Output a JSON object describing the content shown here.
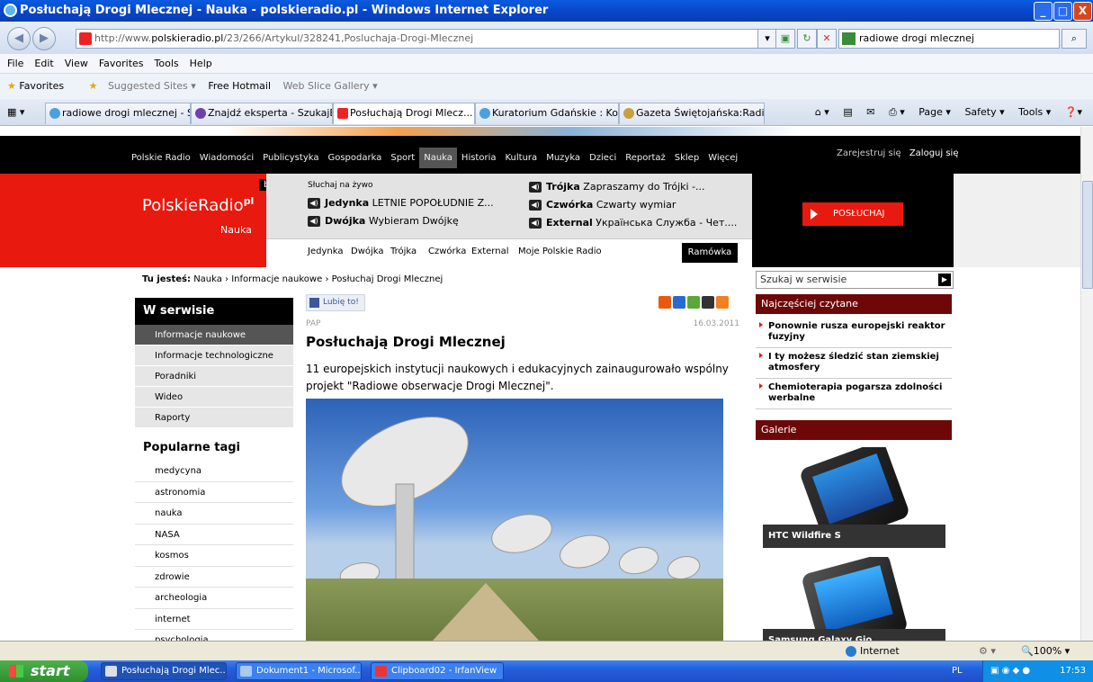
{
  "window": {
    "title": "Posłuchają Drogi Mlecznej - Nauka - polskieradio.pl - Windows Internet Explorer",
    "minimize": "_",
    "maximize": "□",
    "close": "X"
  },
  "address": {
    "url_prefix": "http://www.",
    "url_domain": "polskieradio.pl",
    "url_path": "/23/266/Artykul/328241,Posluchaja-Drogi-Mlecznej",
    "search_value": "radiowe drogi mlecznej"
  },
  "menu": [
    "File",
    "Edit",
    "View",
    "Favorites",
    "Tools",
    "Help"
  ],
  "favorites": {
    "label": "Favorites",
    "items": [
      "Suggested Sites ▾",
      "Free Hotmail",
      "Web Slice Gallery ▾"
    ]
  },
  "tabs": [
    "radiowe drogi mlecznej - Sz...",
    "Znajdź eksperta - SzukajEk...",
    "Posłuchają Drogi Mlecz...",
    "Kuratorium Gdańskie : Kon...",
    "Gazeta Świętojańska:Radi..."
  ],
  "commandbar": [
    "Page ▾",
    "Safety ▾",
    "Tools ▾"
  ],
  "site": {
    "nav": [
      "Polskie Radio",
      "Wiadomości",
      "Publicystyka",
      "Gospodarka",
      "Sport",
      "Nauka",
      "Historia",
      "Kultura",
      "Muzyka",
      "Dzieci",
      "Reportaż",
      "Sklep",
      "Więcej"
    ],
    "register": "Zarejestruj się",
    "login": "Zaloguj się",
    "logo_text": "PolskieRadio",
    "logo_sup": "pl",
    "logo_section": "Nauka",
    "beta": "beta",
    "live_label": "Słuchaj na żywo",
    "channels": [
      {
        "name": "Jedynka",
        "show": "LETNIE POPOŁUDNIE Z..."
      },
      {
        "name": "Dwójka",
        "show": "Wybieram Dwójkę"
      },
      {
        "name": "Trójka",
        "show": "Zapraszamy do Trójki -..."
      },
      {
        "name": "Czwórka",
        "show": "Czwarty wymiar"
      },
      {
        "name": "External",
        "show": "Українська Служба - Чет...."
      }
    ],
    "subnav": [
      "Jedynka",
      "Dwójka",
      "Trójka",
      "Czwórka",
      "External",
      "Moje Polskie Radio"
    ],
    "ramowka": "Ramówka",
    "listen": "POSŁUCHAJ",
    "crumb_label": "Tu jesteś:",
    "crumb": "Nauka › Informacje naukowe › Posłuchaj Drogi Mlecznej",
    "sidebar_head": "W serwisie",
    "sidebar_items": [
      "Informacje naukowe",
      "Informacje technologiczne",
      "Poradniki",
      "Wideo",
      "Raporty"
    ],
    "tags_head": "Popularne tagi",
    "tags": [
      "medycyna",
      "astronomia",
      "nauka",
      "NASA",
      "kosmos",
      "zdrowie",
      "archeologia",
      "internet",
      "psychologia"
    ],
    "like": "Lubię to!",
    "source": "PAP",
    "date": "16.03.2011",
    "article_title": "Posłuchają Drogi Mlecznej",
    "lead": "11 europejskich instytucji naukowych i edukacyjnych zainaugurowało wspólny projekt \"Radiowe obserwacje Drogi Mlecznej\".",
    "search_placeholder": "Szukaj w serwisie",
    "most_read_head": "Najczęściej czytane",
    "most_read": [
      "Ponownie rusza europejski reaktor fuzyjny",
      "I ty możesz śledzić stan ziemskiej atmosfery",
      "Chemioterapia pogarsza zdolności werbalne"
    ],
    "gallery_head": "Galerie",
    "gallery": [
      "HTC Wildfire S",
      "Samsung Galaxy Gio"
    ]
  },
  "status": {
    "zone": "Internet",
    "zoom": "100%"
  },
  "taskbar": {
    "start": "start",
    "tasks": [
      "Posłuchają Drogi Mlec...",
      "Dokument1 - Microsof...",
      "Clipboard02 - IrfanView"
    ],
    "lang": "PL",
    "clock": "17:53"
  },
  "colors": {
    "brand_red": "#e8190e",
    "dark_red": "#6e0808",
    "ie_blue": "#0844c8"
  }
}
